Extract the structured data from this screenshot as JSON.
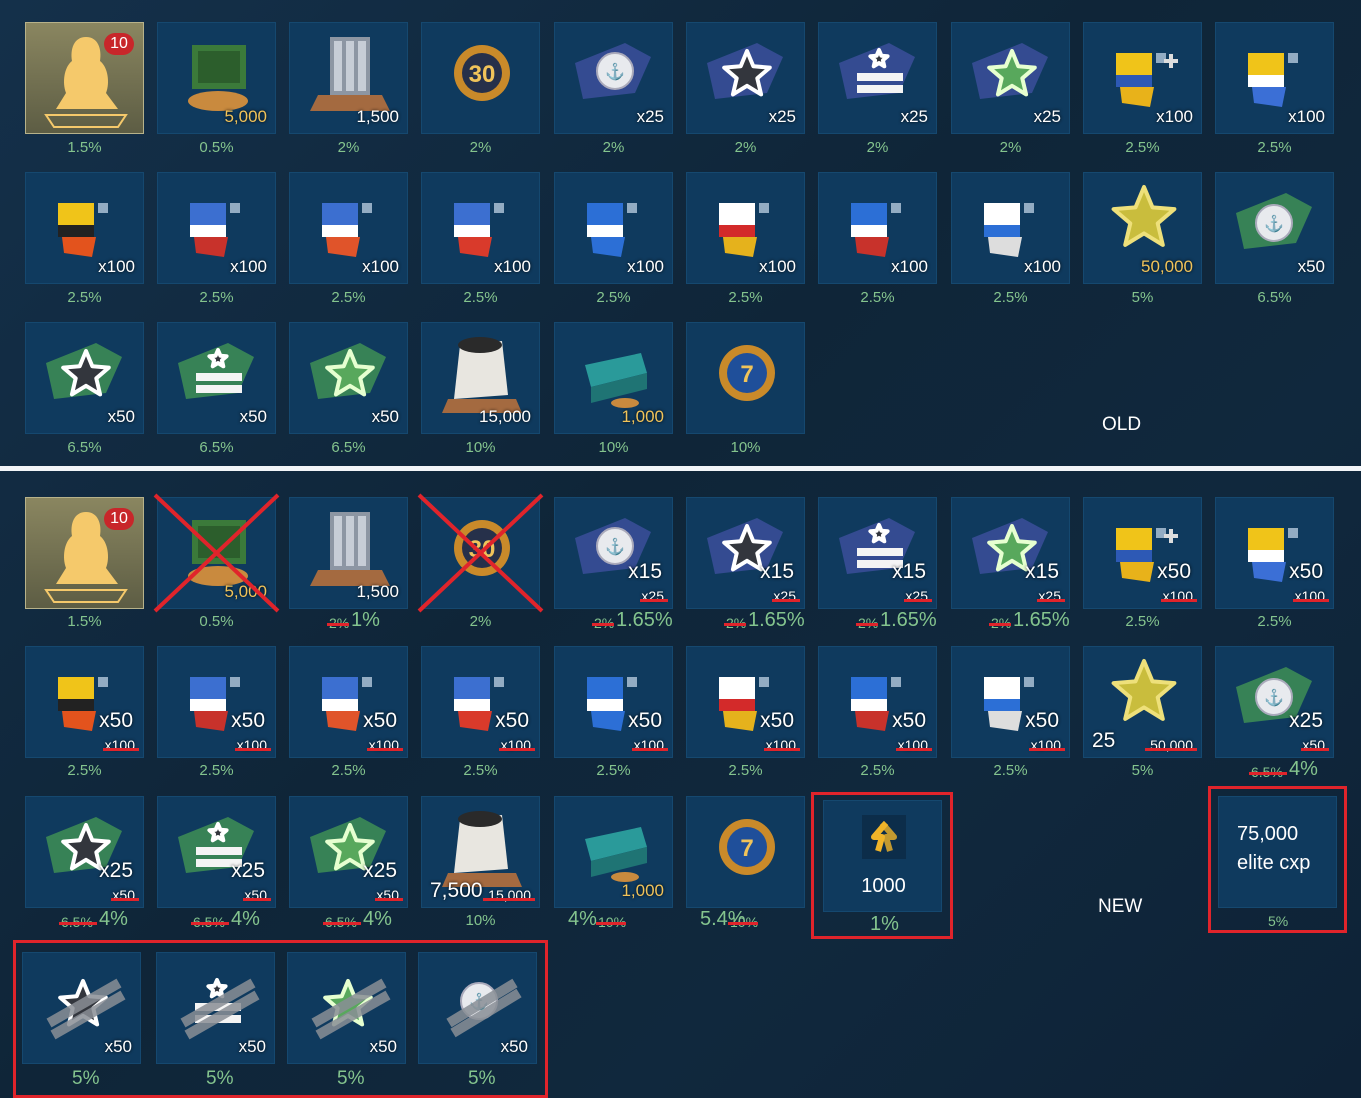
{
  "old_section": {
    "label": "OLD",
    "row1": [
      {
        "icon": "captain-icon",
        "badge": "10",
        "qty": "",
        "pct": "1.5%"
      },
      {
        "icon": "safe-chest-icon",
        "qty": "5,000",
        "gold": true,
        "pct": "0.5%"
      },
      {
        "icon": "steel-icon",
        "qty": "1,500",
        "pct": "2%"
      },
      {
        "icon": "container-30-icon",
        "qty": "",
        "pct": "2%"
      },
      {
        "icon": "anchor-coin-camo-icon",
        "qty": "x25",
        "pct": "2%"
      },
      {
        "icon": "star-camo-icon",
        "qty": "x25",
        "pct": "2%"
      },
      {
        "icon": "stripe-camo-icon",
        "qty": "x25",
        "pct": "2%"
      },
      {
        "icon": "green-star-camo-icon",
        "qty": "x25",
        "pct": "2%"
      },
      {
        "icon": "signal-flag-plus-icon",
        "qty": "x100",
        "pct": "2.5%"
      },
      {
        "icon": "signal-flag-triangle-icon",
        "qty": "x100",
        "pct": "2.5%"
      }
    ],
    "row2": [
      {
        "icon": "signal-flag-extinguisher-icon",
        "qty": "x100",
        "pct": "2.5%"
      },
      {
        "icon": "signal-flag-blast-icon",
        "qty": "x100",
        "pct": "2.5%"
      },
      {
        "icon": "signal-flag-repair-icon",
        "qty": "x100",
        "pct": "2.5%"
      },
      {
        "icon": "signal-flag-gun-icon",
        "qty": "x100",
        "pct": "2.5%"
      },
      {
        "icon": "signal-flag-torpedo-icon",
        "qty": "x100",
        "pct": "2.5%"
      },
      {
        "icon": "signal-flag-cross-icon",
        "qty": "x100",
        "pct": "2.5%"
      },
      {
        "icon": "signal-flag-circle-icon",
        "qty": "x100",
        "pct": "2.5%"
      },
      {
        "icon": "signal-flag-finland-icon",
        "qty": "x100",
        "pct": "2.5%"
      },
      {
        "icon": "gold-star-icon",
        "qty": "50,000",
        "gold": true,
        "pct": "5%"
      },
      {
        "icon": "anchor-coin-green-icon",
        "qty": "x50",
        "pct": "6.5%"
      }
    ],
    "row3": [
      {
        "icon": "star-green-camo-icon",
        "qty": "x50",
        "pct": "6.5%"
      },
      {
        "icon": "stripe-green-camo-icon",
        "qty": "x50",
        "pct": "6.5%"
      },
      {
        "icon": "green-star-green-camo-icon",
        "qty": "x50",
        "pct": "6.5%"
      },
      {
        "icon": "coal-sack-icon",
        "qty": "15,000",
        "pct": "10%"
      },
      {
        "icon": "credits-box-icon",
        "qty": "1,000",
        "gold": true,
        "pct": "10%"
      },
      {
        "icon": "container-7-icon",
        "qty": "",
        "pct": "10%"
      }
    ]
  },
  "new_section": {
    "label": "NEW",
    "row1": [
      {
        "pct": "1.5%",
        "qty": ""
      },
      {
        "pct": "0.5%",
        "qty": "5,000"
      },
      {
        "pct_old": "2%",
        "pct_new": "1%",
        "qty": "1,500"
      },
      {
        "pct": "2%"
      },
      {
        "qty_new": "x15",
        "qty_old": "x25",
        "pct_old": "2%",
        "pct_new": "1.65%"
      },
      {
        "qty_new": "x15",
        "qty_old": "x25",
        "pct_old": "2%",
        "pct_new": "1.65%"
      },
      {
        "qty_new": "x15",
        "qty_old": "x25",
        "pct_old": "2%",
        "pct_new": "1.65%"
      },
      {
        "qty_new": "x15",
        "qty_old": "x25",
        "pct_old": "2%",
        "pct_new": "1.65%"
      },
      {
        "qty_new": "x50",
        "qty_old": "x100",
        "pct": "2.5%"
      },
      {
        "qty_new": "x50",
        "qty_old": "x100",
        "pct": "2.5%"
      }
    ],
    "row2": [
      {
        "qty_new": "x50",
        "qty_old": "x100",
        "pct": "2.5%"
      },
      {
        "qty_new": "x50",
        "qty_old": "x100",
        "pct": "2.5%"
      },
      {
        "qty_new": "x50",
        "qty_old": "x100",
        "pct": "2.5%"
      },
      {
        "qty_new": "x50",
        "qty_old": "x100",
        "pct": "2.5%"
      },
      {
        "qty_new": "x50",
        "qty_old": "x100",
        "pct": "2.5%"
      },
      {
        "qty_new": "x50",
        "qty_old": "x100",
        "pct": "2.5%"
      },
      {
        "qty_new": "x50",
        "qty_old": "x100",
        "pct": "2.5%"
      },
      {
        "qty_new": "x50",
        "qty_old": "x100",
        "pct": "2.5%"
      },
      {
        "qty_new": "25",
        "qty_old": "50,000",
        "pct": "5%"
      },
      {
        "qty_new": "x25",
        "qty_old": "x50",
        "pct_old": "6.5%",
        "pct_new": "4%"
      }
    ],
    "row3": [
      {
        "qty_new": "x25",
        "qty_old": "x50",
        "pct_old": "6.5%",
        "pct_new": "4%"
      },
      {
        "qty_new": "x25",
        "qty_old": "x50",
        "pct_old": "6.5%",
        "pct_new": "4%"
      },
      {
        "qty_new": "x25",
        "qty_old": "x50",
        "pct_old": "6.5%",
        "pct_new": "4%"
      },
      {
        "qty_new": "7,500",
        "qty_old": "15,000",
        "pct": "10%"
      },
      {
        "qty": "1,000",
        "pct_new": "4%",
        "pct_old": "10%"
      },
      {
        "qty": "",
        "pct_new": "5.4%",
        "pct_old": "10%"
      }
    ],
    "new_item": {
      "value": "1000",
      "pct": "1%"
    },
    "elite_cxp": {
      "line1": "75,000",
      "line2": "elite cxp",
      "pct": "5%"
    },
    "added_row": [
      {
        "icon": "star-gray-camo-icon",
        "qty": "x50",
        "pct": "5%"
      },
      {
        "icon": "stripe-gray-camo-icon",
        "qty": "x50",
        "pct": "5%"
      },
      {
        "icon": "green-star-gray-camo-icon",
        "qty": "x50",
        "pct": "5%"
      },
      {
        "icon": "anchor-coin-gray-icon",
        "qty": "x50",
        "pct": "5%"
      }
    ]
  },
  "colors": {
    "accent_red": "#e0242b",
    "pct_green": "#84c48e",
    "cell_bg": "#0f3a5e",
    "gold": "#f0c35a"
  }
}
